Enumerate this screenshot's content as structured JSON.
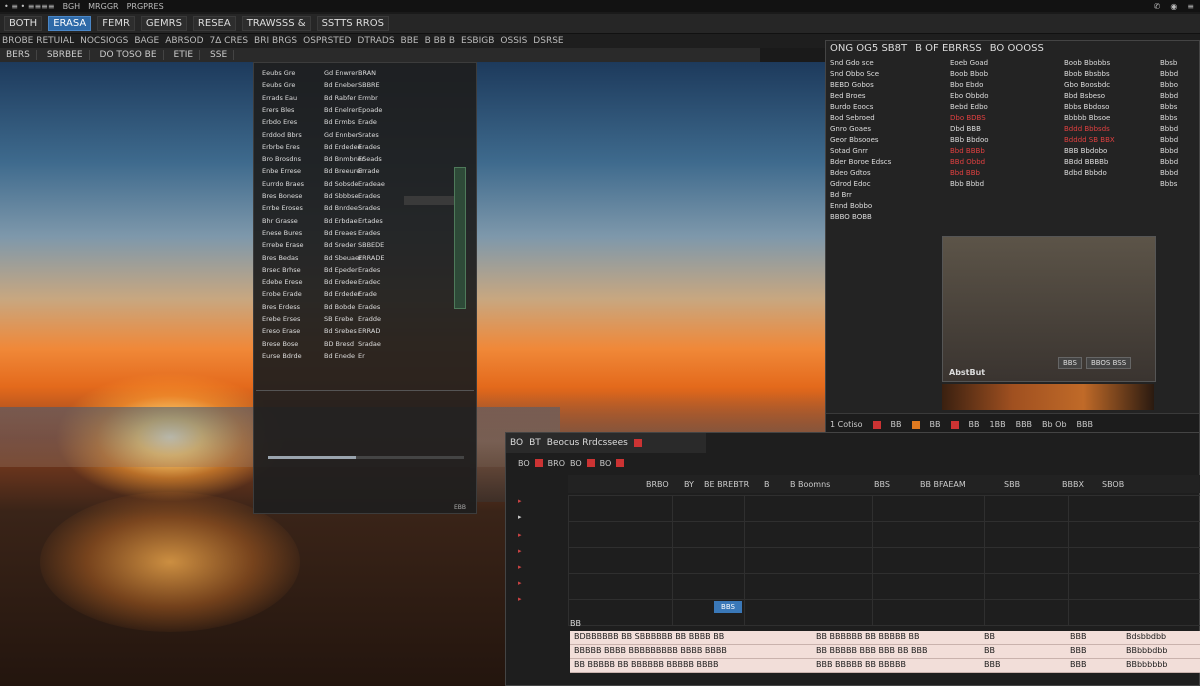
{
  "menubar": {
    "items": [
      "• ≡ • ≡≡≡≡",
      "BGH",
      "MRGGR",
      "PRGPRES"
    ],
    "tray": [
      "✆",
      "◉",
      "≡"
    ]
  },
  "topbar": {
    "buttons": [
      "BOTH",
      "ERASA",
      "FEMR",
      "GEMRS",
      "RESEA",
      "TRAWSSS &",
      "SSTTS RROS"
    ],
    "active_index": 1
  },
  "toolbar": {
    "tools": [
      "BROBE RETUIAL",
      "NOCSIOGS",
      "BAGE",
      "ABRSOD",
      "7∆ CRES",
      "BRI BRGS",
      "OSPRSTED",
      "DTRADS",
      "BBE",
      "B BB B",
      "ESBIGB",
      "OSSIS",
      "DSRSE"
    ]
  },
  "tabstrip": {
    "tabs": [
      "BERS",
      "SBRBEE",
      "DO TOSO BE",
      "ETIE",
      "SSE"
    ]
  },
  "left_panel": {
    "rows": [
      [
        "Eeubs Gre",
        "Gd Enwrer",
        "BRAN"
      ],
      [
        "Eeubs Gre",
        "Bd Eneber",
        "SBBRE"
      ],
      [
        "Errads Eau",
        "Bd Rabfer",
        "Ermbr"
      ],
      [
        "Erers Bles",
        "Bd Enelrer",
        "Epoade"
      ],
      [
        "Erbdo Eres",
        "Bd Ermbs",
        "Erade"
      ],
      [
        "Erddod Bbrs",
        "Gd Ennber",
        "Srates"
      ],
      [
        "Erbrbe Eres",
        "Bd Erdedee",
        "Erades"
      ],
      [
        "Bro Brosdns",
        "Bd Bnmbner",
        "ESeads"
      ],
      [
        "Enbe Errese",
        "Bd Breeurer",
        "Errade"
      ],
      [
        "Eurrdo Braes",
        "Bd Sobsde",
        "Eradeae"
      ],
      [
        "Bres Bonese",
        "Bd Sbbbse",
        "Erades"
      ],
      [
        "Errbe Eroses",
        "Bd Bnrdee",
        "Srades"
      ],
      [
        "Bhr Grasse",
        "Bd Erbdae",
        "Ertades"
      ],
      [
        "Enese Bures",
        "Bd Ereaes",
        "Erades"
      ],
      [
        "Errebe Erase",
        "Bd Sreder",
        "SBBEDE"
      ],
      [
        "Bres Bedas",
        "Bd Sbeuaer",
        "ERRADE"
      ],
      [
        "Brsec Brhse",
        "Bd Epeder",
        "Erades"
      ],
      [
        "Edebe Erese",
        "Bd Eredee",
        "Eradec"
      ],
      [
        "Erobe Erade",
        "Bd Erdeder",
        "Erade"
      ],
      [
        "Bres Erdess",
        "Bd Bobde",
        "Erades"
      ],
      [
        "Erebe Erses",
        "SB Erebe",
        "Eradde"
      ],
      [
        "Ereso Erase",
        "Bd Srebes",
        "ERRAD"
      ],
      [
        "Brese Bose",
        "BD Bresd",
        "Sradae"
      ],
      [
        "Eurse Bdrde",
        "Bd Enede",
        "Er"
      ]
    ],
    "footer": "EBB",
    "progress": 0.45
  },
  "right_panel": {
    "title": [
      "ONG OG5 SB8T",
      "B OF EBRRSS",
      "BO OOOSS"
    ],
    "col1": [
      "Snd Gdo sce",
      "Snd Obbo Sce",
      "BEBD Gobos",
      "Bed Broes",
      "Burdo Eoocs",
      "Bod Sebroed",
      "Gnro Goaes",
      "Geor Bbsooes",
      "Sotad Gnrr",
      "Bder Boroe Edscs",
      "Bdeo Gdtos",
      "Gdrod Edoc",
      "Bd Brr",
      "Ennd Bobbo",
      "BBBO BOBB"
    ],
    "col2": [
      "Eoeb Goad",
      "Boob Bbob",
      "Bbo Ebdo",
      "Ebo Obbdo",
      "Bebd Edbo",
      "Dbo BDBS",
      "Dbd BBB",
      "BBb Bbdoo",
      "Bbd BBBb",
      "BBd Obbd",
      "Bbd BBb",
      "Bbb Bbbd"
    ],
    "col2_red": [
      5,
      8,
      9,
      10
    ],
    "col3": [
      "Boob Bbobbs",
      "Bbob Bbsbbs",
      "Gbo Boosbdc",
      "Bbd Bsbeso",
      "Bbbs Bbdoso",
      "Bbbbb Bbsoe",
      "Bddd Bbbsds",
      "Bdddd SB BBX",
      "BBB Bbdobo",
      "BBdd BBBBb",
      "Bdbd Bbbdo"
    ],
    "col3_red": [
      6,
      7
    ],
    "col4": [
      "Bbsb",
      "Bbbd",
      "Bbbo",
      "Bbbd",
      "Bbbs",
      "Bbbs",
      "Bbbd",
      "Bbbd",
      "Bbbd",
      "Bbbd",
      "Bbbd",
      "Bbbs"
    ],
    "preview_label": "AbstBut",
    "preview_buttons": [
      "BBS",
      "BBOS BSS"
    ],
    "footer": [
      "1 Cotiso",
      "BB",
      "BB",
      "BB",
      "1BB",
      "BBB",
      "Bb Ob",
      "BBB"
    ]
  },
  "bottom_panel": {
    "header": [
      "BO",
      "BT",
      "Beocus Rrdcssees"
    ],
    "tools": [
      "BO",
      "BRO",
      "BO",
      "BO"
    ],
    "columns": [
      "BRBO",
      "BY",
      "BE BREBTR",
      "B",
      "B Boomns",
      "BBS",
      "BB BFAEAM",
      "SBB",
      "BBBX",
      "SBOB"
    ],
    "chip": "BBS",
    "strip_label": "BB",
    "rows": [
      [
        "BDBBBBBB BB SBBBBBB BB BBBB BB",
        "BB BBBBBB BB BBBBB BB",
        "BB",
        "BBB",
        "Bdsbbdbb"
      ],
      [
        "BBBBB BBBB BBBBBBBBB BBBB BBBB",
        "BB BBBBB BBB BBB BB BBB",
        "BB",
        "BBB",
        "BBbbbdbb"
      ],
      [
        "BB BBBBB BB BBBBBB BBBBB BBBB",
        "BBB BBBBB BB BBBBB",
        "BBB",
        "BBB",
        "BBbbbbbb"
      ]
    ]
  }
}
